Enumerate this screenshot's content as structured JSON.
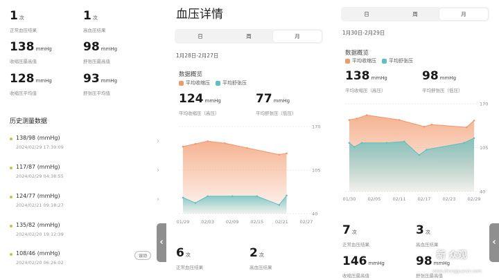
{
  "left_panel": {
    "stats": [
      {
        "value": "1",
        "unit": "次",
        "label": "正常血压结果"
      },
      {
        "value": "1",
        "unit": "次",
        "label": "高血压结果"
      },
      {
        "value": "138",
        "unit": "mmHg",
        "label": "收缩压最高值"
      },
      {
        "value": "98",
        "unit": "mmHg",
        "label": "舒张压最高值"
      },
      {
        "value": "128",
        "unit": "mmHg",
        "label": "收缩压平均值"
      },
      {
        "value": "93",
        "unit": "mmHg",
        "label": "舒张压平均值"
      }
    ],
    "history_title": "历史测量数据",
    "history": [
      {
        "value": "138/98 (mmHg)",
        "time": "2024/02/29 17:39:09"
      },
      {
        "value": "117/87 (mmHg)",
        "time": "2024/02/29 04:38:55"
      },
      {
        "value": "124/77 (mmHg)",
        "time": "2024/02/21 09:18:27"
      },
      {
        "value": "135/82 (mmHg)",
        "time": "2024/02/20 19:12:39"
      },
      {
        "value": "108/46 (mmHg)",
        "time": "2024/02/20 06:26:02",
        "badge": "误动"
      }
    ]
  },
  "middle_panel": {
    "title": "血压详情",
    "tabs": [
      "日",
      "周",
      "月"
    ],
    "active_tab": "月",
    "date_range": "1月28日-2月27日",
    "overview_title": "数据概览",
    "legend": [
      "平均收缩压",
      "平均舒张压"
    ],
    "avg_sys": {
      "value": "124",
      "unit": "mmHg",
      "label": "平均收缩压（高压）"
    },
    "avg_dia": {
      "value": "77",
      "unit": "mmHg",
      "label": "平均舒张压（低压）"
    },
    "bottom_stats": [
      {
        "value": "6",
        "unit": "次",
        "label": "正常血压结果"
      },
      {
        "value": "2",
        "unit": "次",
        "label": "高血压结果"
      }
    ]
  },
  "right_panel": {
    "tabs": [
      "日",
      "周",
      "月"
    ],
    "active_tab": "月",
    "date_range": "1月30日-2月29日",
    "overview_title": "数据概览",
    "legend": [
      "平均收缩压",
      "平均舒张压"
    ],
    "avg_sys": {
      "value": "138",
      "unit": "mmHg",
      "label": "平均收缩压（高压）"
    },
    "avg_dia": {
      "value": "98",
      "unit": "mmHg",
      "label": "平均舒张压（低压）"
    },
    "bottom_stats": [
      {
        "value": "7",
        "unit": "次",
        "label": "正常血压结果"
      },
      {
        "value": "3",
        "unit": "次",
        "label": "高血压结果"
      },
      {
        "value": "146",
        "unit": "mmHg",
        "label": "收缩压最高值"
      },
      {
        "value": "98",
        "unit": "mmHg",
        "label": "舒张压最高值"
      }
    ]
  },
  "watermark": {
    "text": "新 众观",
    "sub": "www.zhongguanzn.com"
  },
  "colors": {
    "systolic": "#f29a6e",
    "diastolic": "#5ec1c2"
  },
  "chart_data": [
    {
      "type": "area",
      "yticks": [
        40,
        105,
        170
      ],
      "ylim": [
        40,
        170
      ],
      "x": [
        "01/29",
        "02/03",
        "02/09",
        "02/15",
        "02/21",
        "02/27"
      ],
      "series": [
        {
          "name": "平均收缩压",
          "points": [
            [
              0,
              140
            ],
            [
              0.5,
              144
            ],
            [
              1.0,
              148
            ],
            [
              1.7,
              145
            ],
            [
              2.6,
              138
            ],
            [
              3.9,
              128
            ],
            [
              4.2,
              130
            ]
          ]
        },
        {
          "name": "平均舒张压",
          "points": [
            [
              0,
              64
            ],
            [
              0.5,
              56
            ],
            [
              1.0,
              66
            ],
            [
              2.0,
              66
            ],
            [
              3.0,
              66
            ],
            [
              3.9,
              53
            ],
            [
              4.2,
              67
            ]
          ]
        }
      ]
    },
    {
      "type": "area",
      "yticks": [
        40,
        105,
        170
      ],
      "ylim": [
        40,
        170
      ],
      "x": [
        "01/30",
        "02/05",
        "02/11",
        "02/17",
        "02/23",
        "02/29"
      ],
      "series": [
        {
          "name": "平均收缩压",
          "points": [
            [
              0,
              146
            ],
            [
              0.3,
              148
            ],
            [
              0.7,
              153
            ],
            [
              2.0,
              146
            ],
            [
              3.0,
              136
            ],
            [
              3.3,
              139
            ],
            [
              4.7,
              135
            ],
            [
              5.0,
              145
            ]
          ]
        },
        {
          "name": "平均舒张压",
          "points": [
            [
              0,
              112
            ],
            [
              0.2,
              106
            ],
            [
              0.5,
              112
            ],
            [
              1.5,
              112
            ],
            [
              2.2,
              114
            ],
            [
              2.8,
              94
            ],
            [
              3.1,
              102
            ],
            [
              4.6,
              112
            ],
            [
              5.0,
              119
            ]
          ]
        }
      ]
    }
  ]
}
